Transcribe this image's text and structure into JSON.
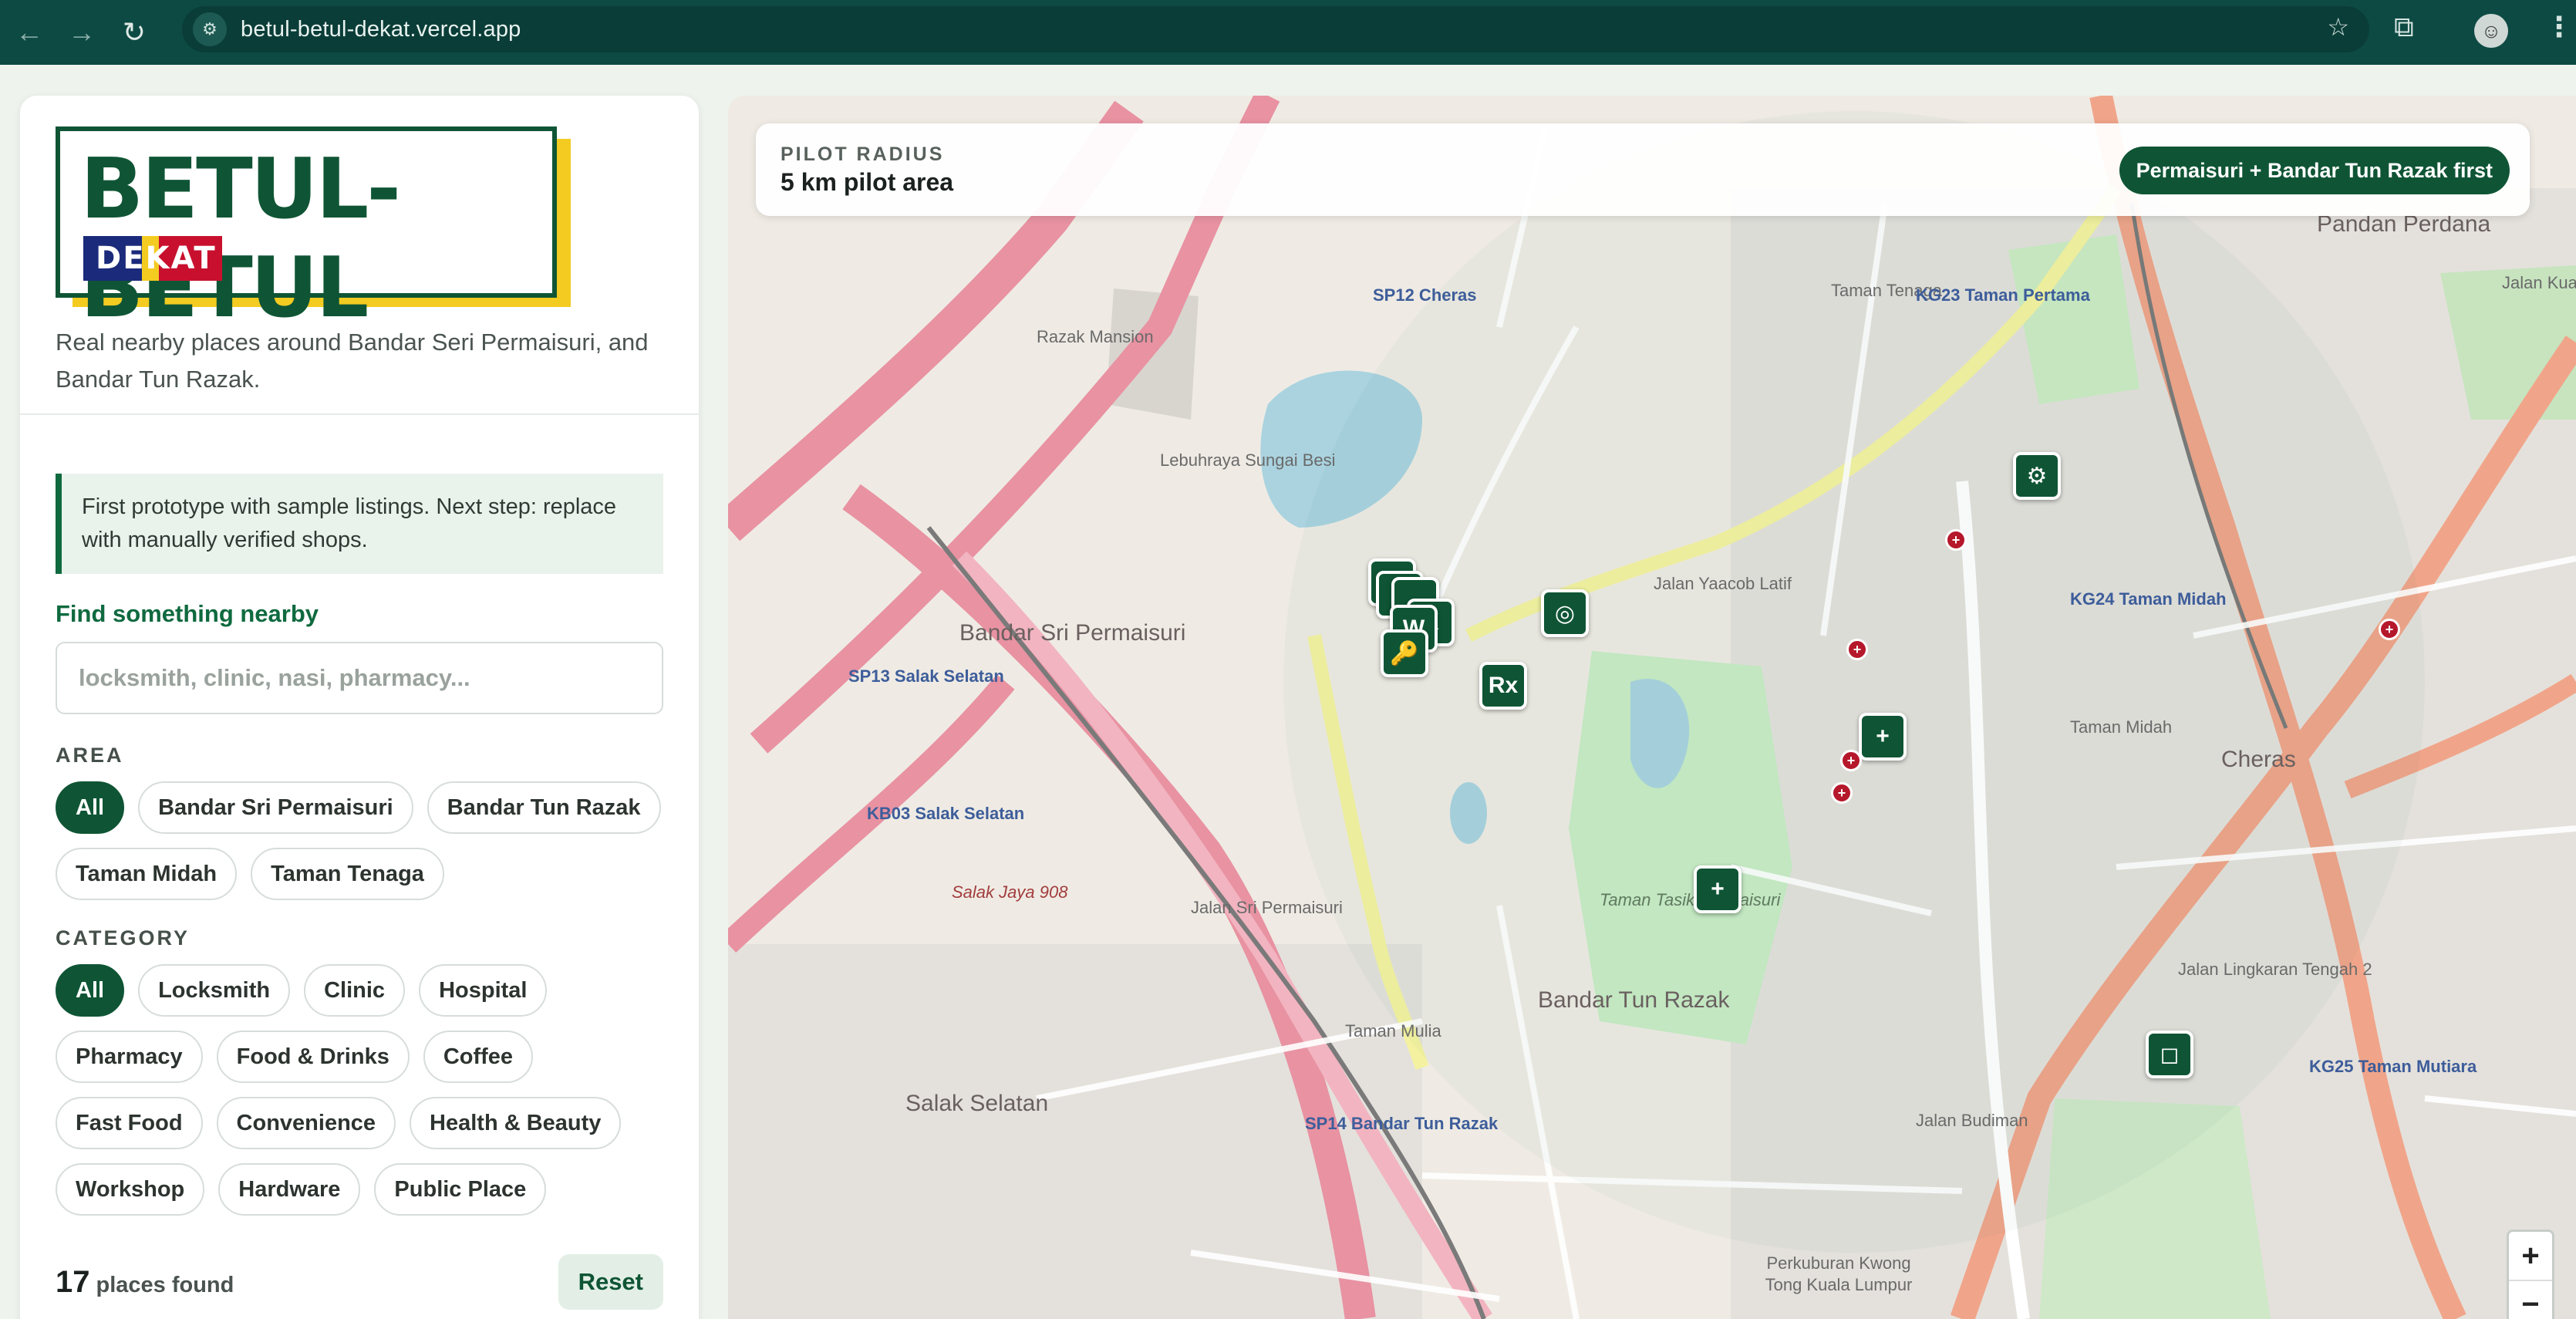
{
  "browser": {
    "url": "betul-betul-dekat.vercel.app",
    "icons": {
      "back": "arrow-left-icon",
      "forward": "arrow-right-icon",
      "reload": "reload-icon",
      "site": "site-settings-icon",
      "bookmark": "star-icon",
      "extensions": "puzzle-icon",
      "menu": "kebab-icon"
    }
  },
  "sidebar": {
    "logo_main": "BETUL-BETUL",
    "logo_sub": "DEKAT",
    "tagline": "Real nearby places around Bandar Seri Permaisuri, and Bandar Tun Razak.",
    "notice": "First prototype with sample listings. Next step: replace with manually verified shops.",
    "find_label": "Find something nearby",
    "search_placeholder": "locksmith, clinic, nasi, pharmacy...",
    "area_label": "AREA",
    "areas": [
      "All",
      "Bandar Sri Permaisuri",
      "Bandar Tun Razak",
      "Taman Midah",
      "Taman Tenaga"
    ],
    "category_label": "CATEGORY",
    "categories": [
      "All",
      "Locksmith",
      "Clinic",
      "Hospital",
      "Pharmacy",
      "Food & Drinks",
      "Coffee",
      "Fast Food",
      "Convenience",
      "Health & Beauty",
      "Workshop",
      "Hardware",
      "Public Place"
    ],
    "count": "17",
    "count_label": "places found",
    "reset_label": "Reset"
  },
  "map": {
    "radius_label": "PILOT RADIUS",
    "radius_value": "5 km pilot area",
    "priority_button": "Permaisuri + Bandar Tun Razak first",
    "markers": {
      "key": "🔑",
      "rx": "Rx",
      "w": "W",
      "k": "K",
      "gear": "⚙",
      "target": "◎",
      "plus": "+",
      "square": "◻"
    },
    "labels": {
      "bandar_sri_permaisuri": "Bandar Sri Permaisuri",
      "bandar_tun_razak": "Bandar Tun Razak",
      "salak_selatan": "Salak Selatan",
      "cheras": "Cheras",
      "pandan_perdana": "Pandan Perdana",
      "taman_tenaga": "Taman Tenaga",
      "taman_midah": "Taman Midah",
      "taman_tasik_permaisuri": "Taman Tasik Permaisuri",
      "sp12": "SP12 Cheras",
      "sp13": "SP13 Salak Selatan",
      "sp14": "SP14 Bandar Tun Razak",
      "kb03": "KB03 Salak Selatan",
      "kg23": "KG23 Taman Pertama",
      "kg24": "KG24 Taman Midah",
      "kg25": "KG25 Taman Mutiara",
      "taman_mulia": "Taman Mulia",
      "razak_mansion": "Razak Mansion",
      "jalan_budiman": "Jalan Budiman",
      "jalan_sri_permaisuri": "Jalan Sri Permaisuri",
      "lebuhraya_sungai_besi": "Lebuhraya Sungai Besi",
      "jalan_lingkaran_tengah": "Jalan Lingkaran Tengah 2",
      "perkuburan": "Perkuburan Kwong Tong Kuala Lumpur",
      "jalan_yaacob_latif": "Jalan Yaacob Latif",
      "jalan_kuari": "Jalan Kuari",
      "salak_jaya": "Salak Jaya 908"
    },
    "zoom_in": "+",
    "zoom_out": "−"
  }
}
